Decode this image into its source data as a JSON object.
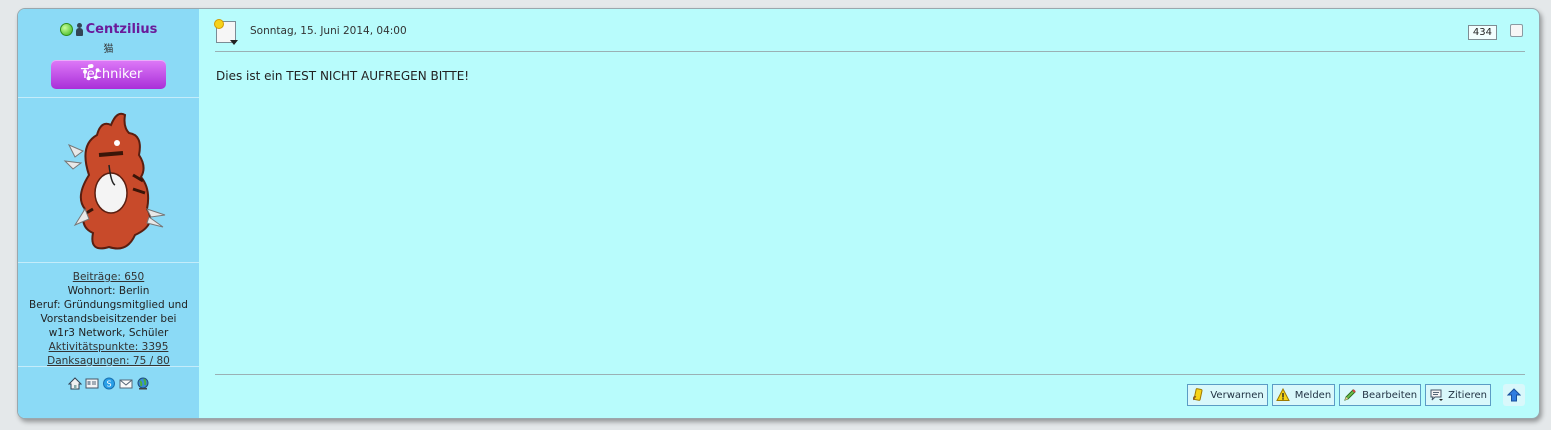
{
  "user": {
    "name": "Centzilius",
    "title": "猫",
    "rank": "Techniker",
    "stats": {
      "posts": "Beiträge: 650",
      "residence": "Wohnort: Berlin",
      "occupation_lines": [
        "Beruf: Gründungsmitglied und",
        "Vorstandsbeisitzender bei",
        "w1r3 Network, Schüler"
      ],
      "activity": "Aktivitätspunkte: 3395",
      "thanks": "Danksagungen: 75 / 80"
    },
    "contact_icons": [
      "home-icon",
      "profile-card-icon",
      "skype-icon",
      "email-icon",
      "website-globe-icon"
    ]
  },
  "post": {
    "date": "Sonntag, 15. Juni 2014, 04:00",
    "number": "434",
    "body": "Dies ist ein TEST NICHT AUFREGEN BITTE!"
  },
  "actions": {
    "warn": "Verwarnen",
    "report": "Melden",
    "edit": "Bearbeiten",
    "quote": "Zitieren"
  },
  "colors": {
    "post_bg": "#b8fcfc",
    "sidebar_bg": "#8bdaf6",
    "username": "#6a1b9a",
    "rank_badge": "#c055e8",
    "button_border": "#5b9cc5"
  }
}
